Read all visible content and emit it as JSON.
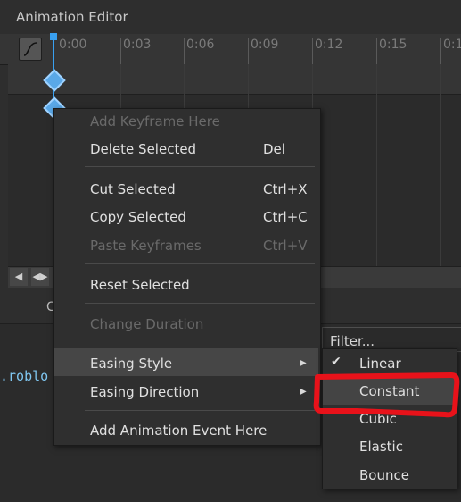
{
  "window": {
    "title": "Animation Editor"
  },
  "timeline": {
    "ticks": [
      "0:00",
      "0:03",
      "0:06",
      "0:09",
      "0:12",
      "0:15",
      "0:1"
    ]
  },
  "lower_panel": {
    "tab_label": "C",
    "code_snippet": ".roblo"
  },
  "context_menu": {
    "items": [
      {
        "label": "Add Keyframe Here",
        "shortcut": "",
        "enabled": false
      },
      {
        "label": "Delete Selected",
        "shortcut": "Del",
        "enabled": true
      },
      {
        "label": "Cut Selected",
        "shortcut": "Ctrl+X",
        "enabled": true
      },
      {
        "label": "Copy Selected",
        "shortcut": "Ctrl+C",
        "enabled": true
      },
      {
        "label": "Paste Keyframes",
        "shortcut": "Ctrl+V",
        "enabled": false
      },
      {
        "label": "Reset Selected",
        "shortcut": "",
        "enabled": true
      },
      {
        "label": "Change Duration",
        "shortcut": "",
        "enabled": false
      },
      {
        "label": "Easing Style",
        "shortcut": "",
        "enabled": true
      },
      {
        "label": "Easing Direction",
        "shortcut": "",
        "enabled": true
      },
      {
        "label": "Add Animation Event Here",
        "shortcut": "",
        "enabled": true
      }
    ]
  },
  "easing_submenu": {
    "filter_label": "Filter...",
    "items": [
      "Linear",
      "Constant",
      "Cubic",
      "Elastic",
      "Bounce"
    ],
    "checked": "Linear",
    "hovered": "Constant"
  },
  "colors": {
    "accent": "#39a0f0",
    "annotation": "#e8121a"
  }
}
